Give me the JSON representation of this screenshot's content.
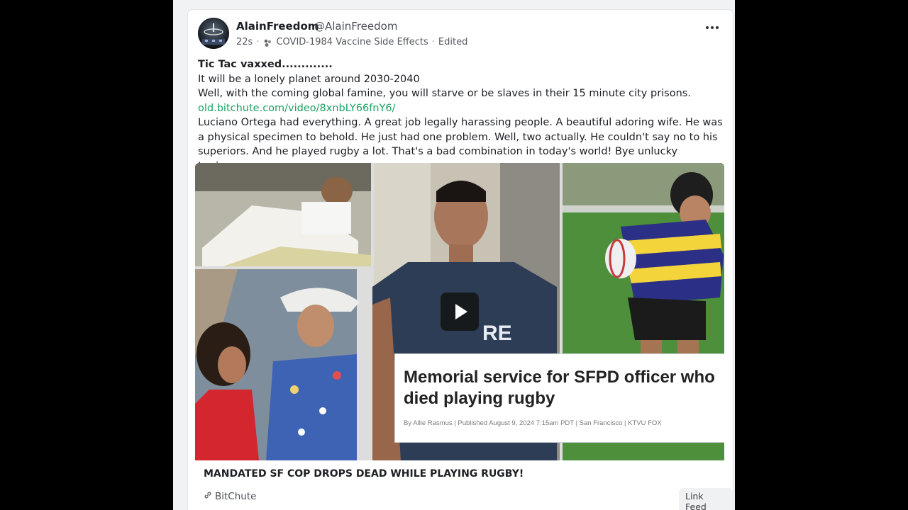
{
  "post": {
    "author_name": "AlainFreedom",
    "author_handle": "@AlainFreedom",
    "time": "22s",
    "community": "COVID-1984 Vaccine Side Effects",
    "edited": "Edited",
    "body": {
      "headline": "Tic Tac vaxxed.............",
      "line1": "It will be a lonely planet around 2030-2040",
      "line2": "Well, with the coming global famine, you will starve or be slaves in their 15 minute city prisons.",
      "link": "old.bitchute.com/video/8xnbLY66fnY6/",
      "line3": "Luciano Ortega had everything. A great job legally harassing people. A beautiful adoring wife. He was a physical specimen to behold. He just had one problem. Well, two actually. He couldn't say no to his superiors. And he played rugby a lot. That's a bad combination in today's world! Bye unlucky Luciano."
    },
    "embed": {
      "caption_title": "Memorial service for SFPD officer who died playing rugby",
      "caption_byline": "By Allie Rasmus  |  Published August 9, 2024 7:15am PDT  |  San Francisco  |  KTVU FOX",
      "link_title": "MANDATED SF COP DROPS DEAD WHILE PLAYING RUGBY!",
      "source": "BitChute",
      "badge": "Link Feed"
    }
  },
  "icons": {
    "more": "more-horizontal-icon",
    "play": "play-icon",
    "link": "link-icon",
    "community": "community-icon"
  },
  "colors": {
    "link": "#1aa463",
    "background": "#000000",
    "card": "#ffffff"
  }
}
